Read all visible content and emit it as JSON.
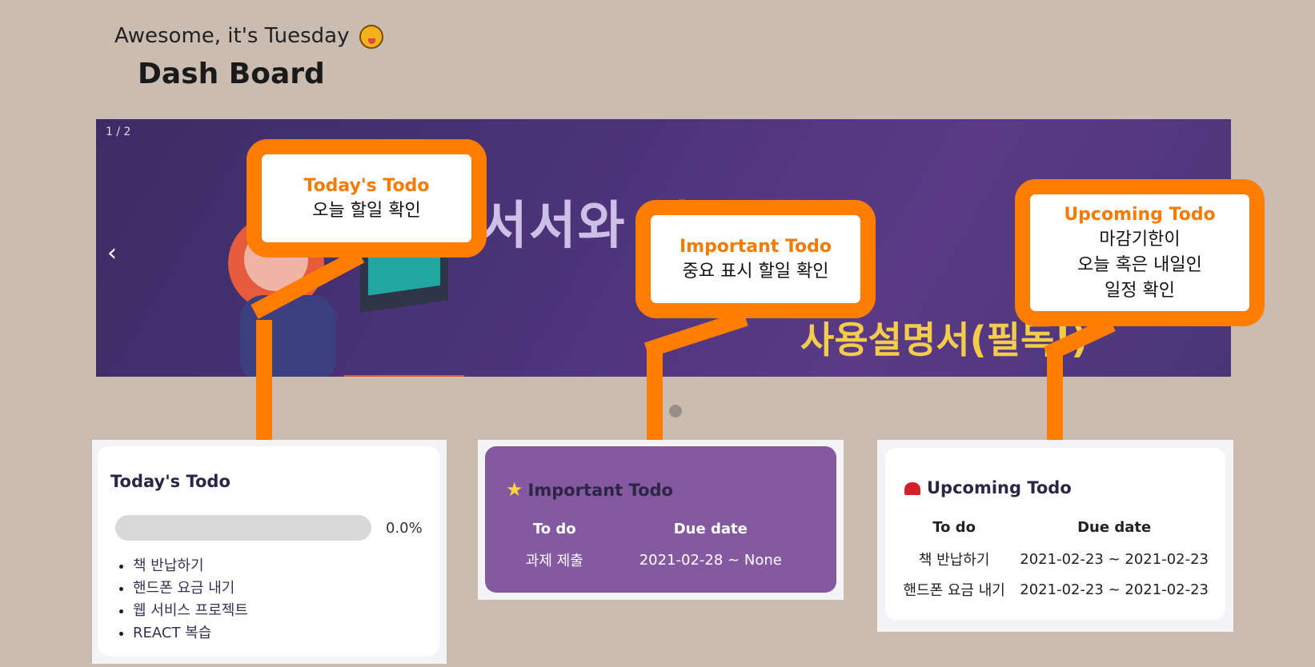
{
  "header": {
    "greeting": "Awesome, it's Tuesday",
    "title": "Dash Board"
  },
  "banner": {
    "counter": "1 / 2",
    "prev_label": "‹",
    "text_line1": "서서와 다",
    "text_line2": "처음",
    "text_line3": "사용설명서(필독!)"
  },
  "callouts": {
    "today": {
      "title": "Today's Todo",
      "desc": "오늘 할일 확인"
    },
    "important": {
      "title": "Important Todo",
      "desc": "중요 표시 할일 확인"
    },
    "upcoming": {
      "title": "Upcoming Todo",
      "desc_lines": [
        "마감기한이",
        "오늘 혹은 내일인",
        "일정 확인"
      ]
    }
  },
  "today_card": {
    "title": "Today's Todo",
    "progress_percent": 0.0,
    "progress_label": "0.0%",
    "items": [
      "책 반납하기",
      "핸드폰 요금 내기",
      "웹 서비스 프로젝트",
      "REACT 복습"
    ]
  },
  "important_card": {
    "title": "Important Todo",
    "columns": [
      "To do",
      "Due date"
    ],
    "rows": [
      [
        "과제 제출",
        "2021-02-28 ~ None"
      ]
    ]
  },
  "upcoming_card": {
    "title": "Upcoming Todo",
    "columns": [
      "To do",
      "Due date"
    ],
    "rows": [
      [
        "책 반납하기",
        "2021-02-23 ~ 2021-02-23"
      ],
      [
        "핸드폰 요금 내기",
        "2021-02-23 ~ 2021-02-23"
      ]
    ]
  },
  "icons": {
    "greeting": "tongue-out-emoji-icon",
    "important": "star-icon",
    "upcoming": "siren-icon"
  },
  "colors": {
    "background": "#cbbcb2",
    "callout": "#ff7d00",
    "important_card": "#84599f"
  }
}
